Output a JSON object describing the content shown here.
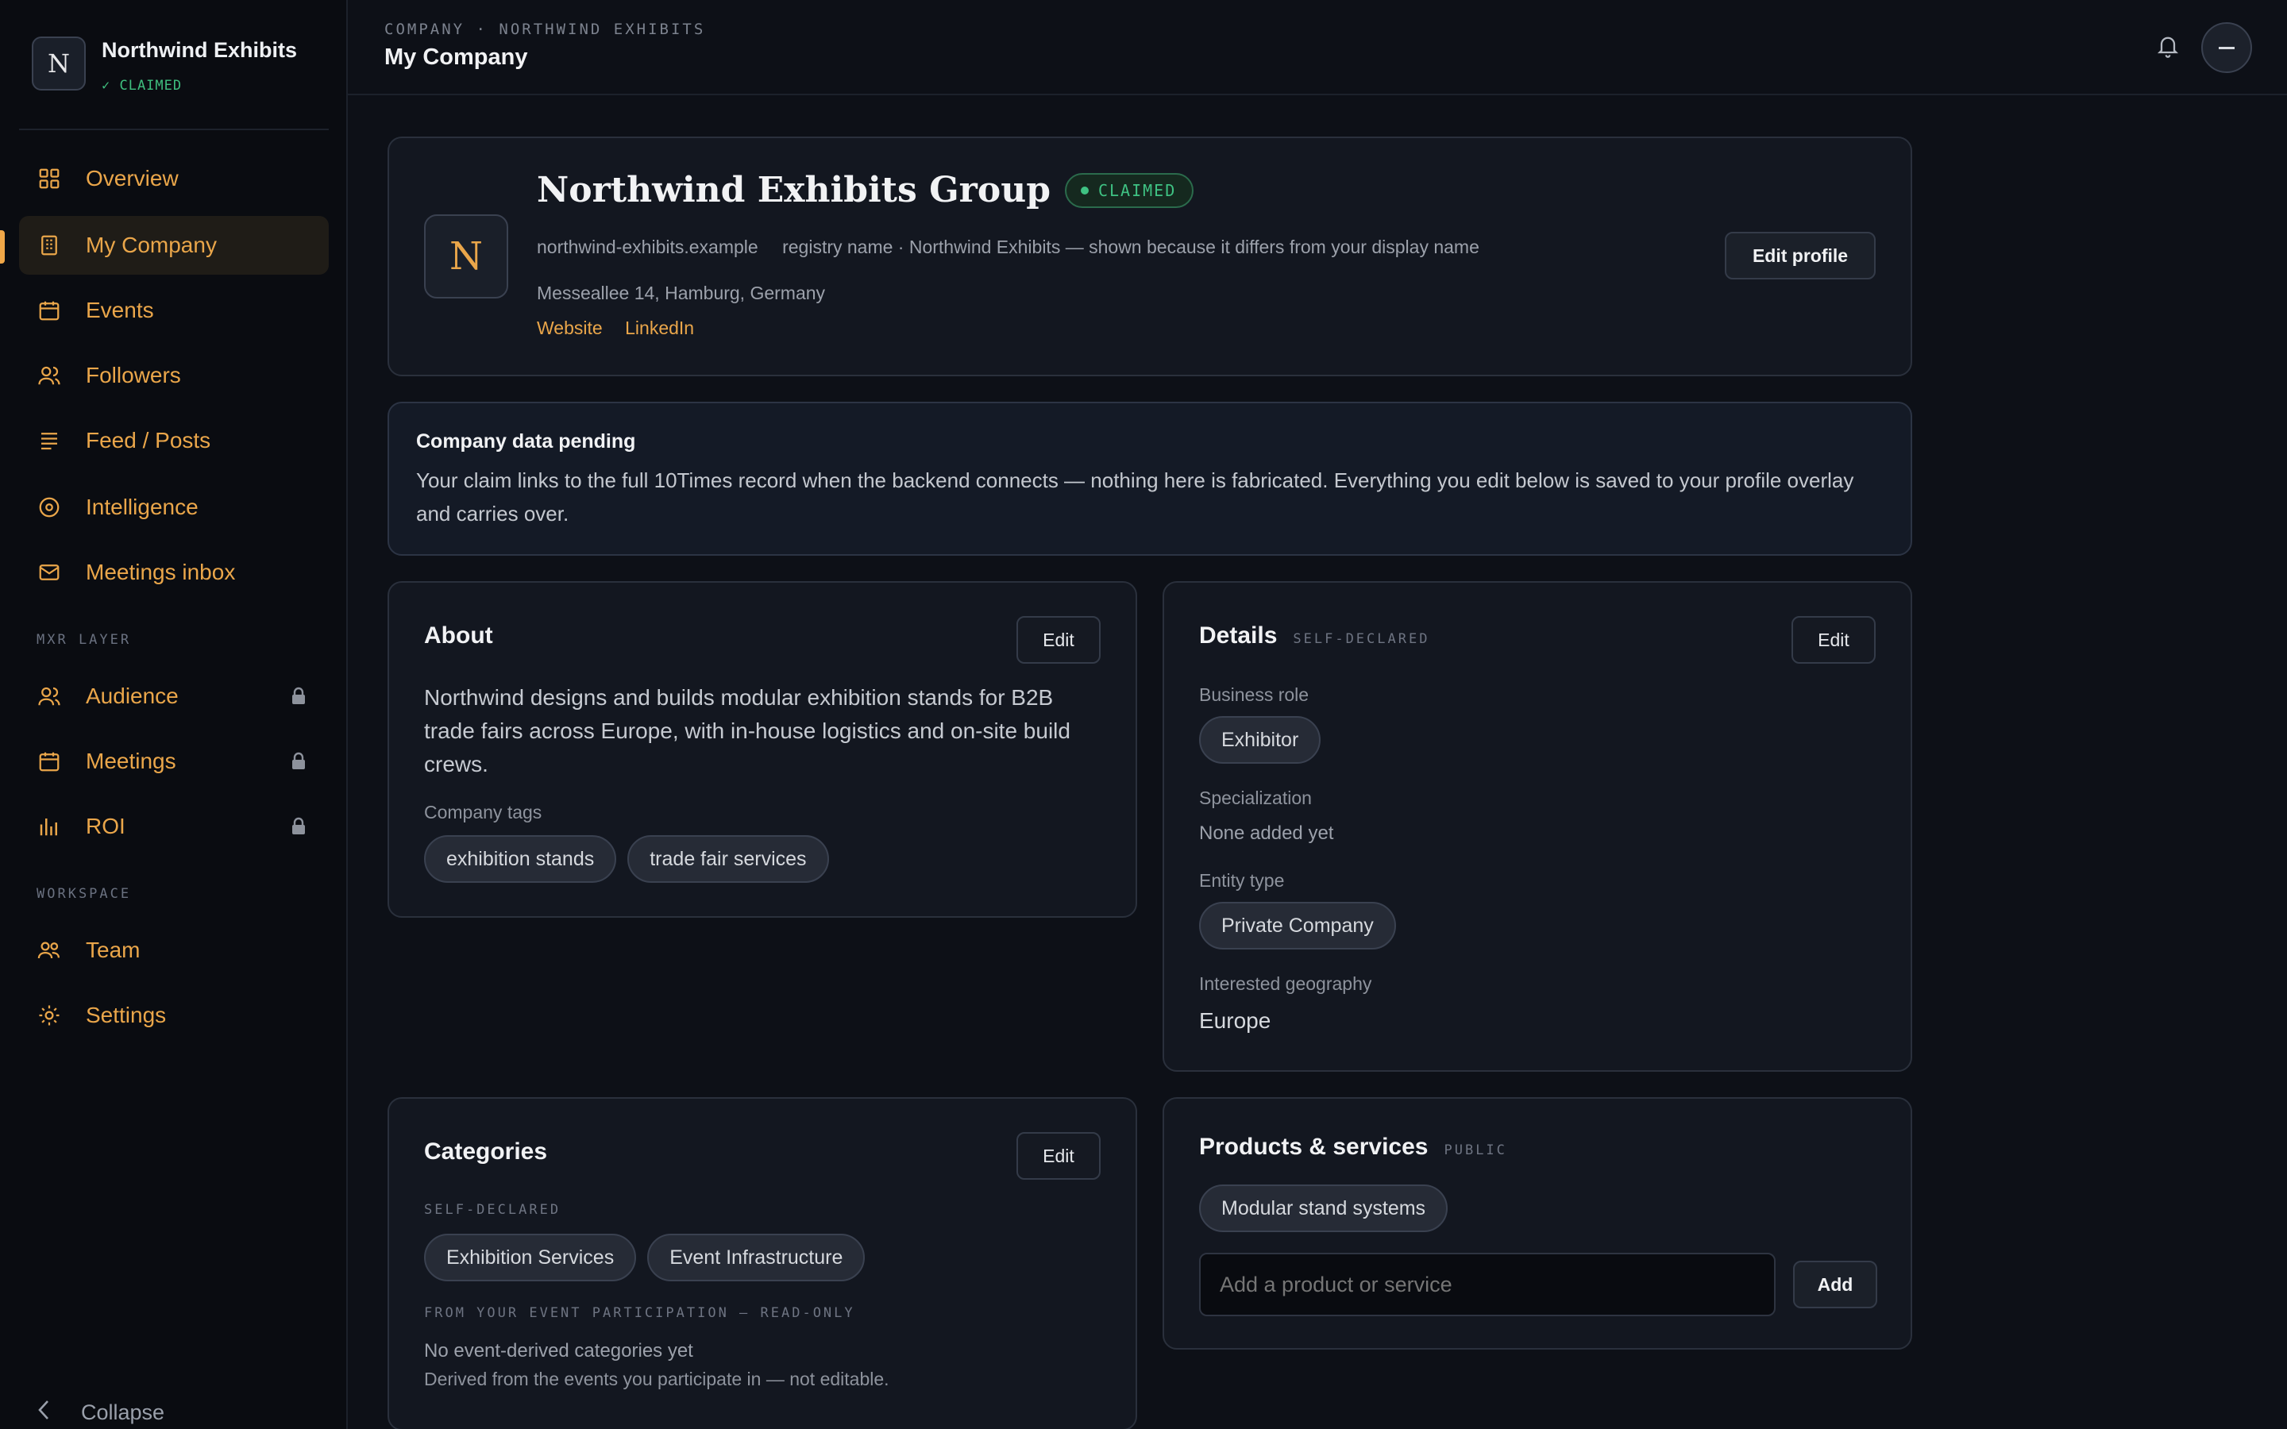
{
  "brand": {
    "initial": "N",
    "name": "Northwind Exhibits",
    "status": "✓ CLAIMED"
  },
  "nav": {
    "main": [
      {
        "label": "Overview",
        "icon": "grid-icon"
      },
      {
        "label": "My Company",
        "icon": "building-icon",
        "active": true
      },
      {
        "label": "Events",
        "icon": "calendar-icon"
      },
      {
        "label": "Followers",
        "icon": "users-icon"
      },
      {
        "label": "Feed / Posts",
        "icon": "feed-icon"
      },
      {
        "label": "Intelligence",
        "icon": "target-icon"
      },
      {
        "label": "Meetings inbox",
        "icon": "mail-icon"
      }
    ],
    "mxr_heading": "MXR LAYER",
    "mxr": [
      {
        "label": "Audience",
        "icon": "users-icon",
        "locked": true
      },
      {
        "label": "Meetings",
        "icon": "calendar-icon",
        "locked": true
      },
      {
        "label": "ROI",
        "icon": "bar-chart-icon",
        "locked": true
      }
    ],
    "workspace_heading": "WORKSPACE",
    "workspace": [
      {
        "label": "Team",
        "icon": "team-icon"
      },
      {
        "label": "Settings",
        "icon": "gear-icon"
      }
    ],
    "collapse": "Collapse"
  },
  "header": {
    "breadcrumb": "COMPANY · NORTHWIND EXHIBITS",
    "title": "My Company"
  },
  "profile": {
    "initial": "N",
    "name": "Northwind Exhibits Group",
    "badge": "CLAIMED",
    "domain": "northwind-exhibits.example",
    "registry_note": "registry name · Northwind Exhibits — shown because it differs from your display name",
    "address": "Messeallee 14, Hamburg, Germany",
    "links": [
      "Website",
      "LinkedIn"
    ],
    "edit_label": "Edit profile"
  },
  "notice": {
    "title": "Company data pending",
    "body": "Your claim links to the full 10Times record when the backend connects — nothing here is fabricated. Everything you edit below is saved to your profile overlay and carries over."
  },
  "about": {
    "title": "About",
    "edit_label": "Edit",
    "text": "Northwind designs and builds modular exhibition stands for B2B trade fairs across Europe, with in-house logistics and on-site build crews.",
    "tags_label": "Company tags",
    "tags": [
      "exhibition stands",
      "trade fair services"
    ]
  },
  "details": {
    "title": "Details",
    "tag": "SELF-DECLARED",
    "edit_label": "Edit",
    "business_role_label": "Business role",
    "business_role": "Exhibitor",
    "specialization_label": "Specialization",
    "specialization": "None added yet",
    "entity_type_label": "Entity type",
    "entity_type": "Private Company",
    "geography_label": "Interested geography",
    "geography": "Europe"
  },
  "categories": {
    "title": "Categories",
    "edit_label": "Edit",
    "self_declared_label": "SELF-DECLARED",
    "items": [
      "Exhibition Services",
      "Event Infrastructure"
    ],
    "event_label": "FROM YOUR EVENT PARTICIPATION — READ-ONLY",
    "event_empty": "No event-derived categories yet",
    "event_note": "Derived from the events you participate in — not editable."
  },
  "products": {
    "title": "Products & services",
    "tag": "PUBLIC",
    "items": [
      "Modular stand systems"
    ],
    "placeholder": "Add a product or service",
    "add_label": "Add"
  },
  "colors": {
    "accent": "#eaa64a",
    "success": "#3fc283",
    "bg": "#0d1017",
    "card": "#131720"
  }
}
